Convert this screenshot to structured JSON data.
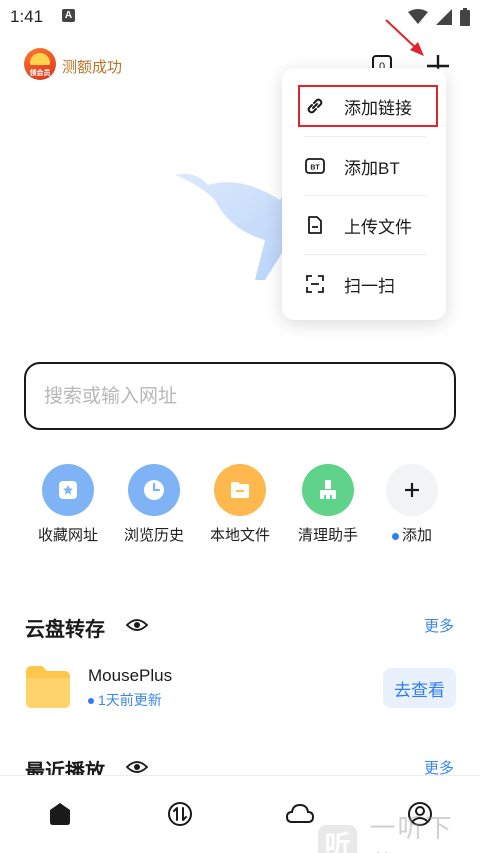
{
  "status_bar": {
    "time": "1:41",
    "notification_letter": "A"
  },
  "header": {
    "member_badge_text": "领会员",
    "member_text": "测额成功"
  },
  "menu": {
    "items": [
      {
        "label": "添加链接",
        "icon": "link-icon"
      },
      {
        "label": "添加BT",
        "icon": "bt-icon",
        "icon_text": "BT"
      },
      {
        "label": "上传文件",
        "icon": "upload-file-icon"
      },
      {
        "label": "扫一扫",
        "icon": "scan-icon"
      }
    ],
    "highlight_color": "#e0242c"
  },
  "search": {
    "placeholder": "搜索或输入网址"
  },
  "shortcuts": [
    {
      "label": "收藏网址",
      "icon": "bookmark-icon",
      "color": "#7fb3f5"
    },
    {
      "label": "浏览历史",
      "icon": "clock-icon",
      "color": "#7fb3f5"
    },
    {
      "label": "本地文件",
      "icon": "folder-icon",
      "color": "#ffb84d"
    },
    {
      "label": "清理助手",
      "icon": "broom-icon",
      "color": "#5fd38a"
    },
    {
      "label": "添加",
      "icon": "plus-icon",
      "color": "#f2f3f5"
    }
  ],
  "cloud_section": {
    "title": "云盘转存",
    "more": "更多",
    "item": {
      "title": "MousePlus",
      "subtitle": "1天前更新",
      "button": "去查看"
    }
  },
  "recent_section": {
    "title": "最近播放",
    "more": "更多"
  },
  "bottom_nav": [
    "home-icon",
    "transfer-icon",
    "cloud-icon",
    "profile-icon"
  ],
  "watermark": {
    "logo": "听",
    "text": "一听下载"
  },
  "accent_color": "#3a86f0"
}
